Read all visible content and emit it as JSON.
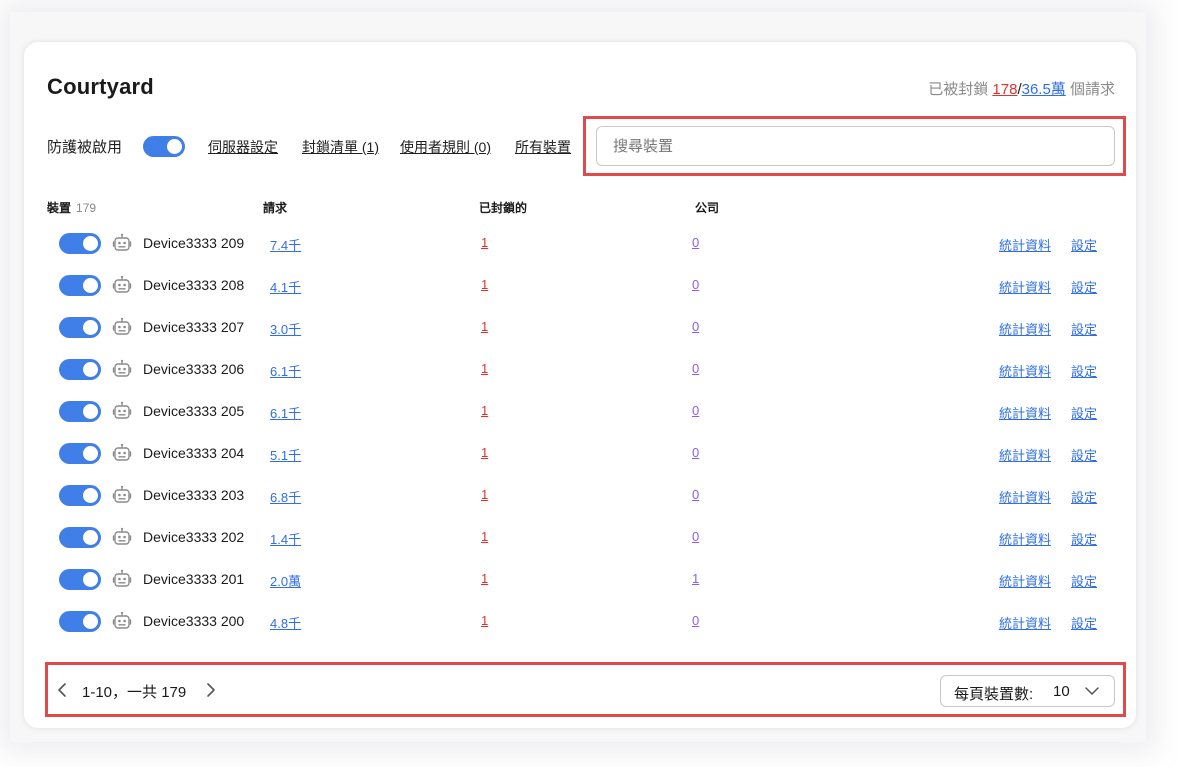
{
  "header": {
    "title": "Courtyard",
    "summary_prefix": "已被封鎖",
    "blocked_count": "178",
    "separator": "/",
    "total_requests": "36.5萬",
    "summary_suffix": "個請求"
  },
  "toolbar": {
    "protection_label": "防護被啟用",
    "links": [
      "伺服器設定",
      "封鎖清單 (1)",
      "使用者規則 (0)",
      "所有裝置"
    ]
  },
  "search": {
    "placeholder": "搜尋裝置",
    "value": ""
  },
  "table": {
    "headers": {
      "device": "裝置",
      "device_count": "179",
      "requests": "請求",
      "blocked": "已封鎖的",
      "company": "公司"
    },
    "rows": [
      {
        "name": "Device3333 209",
        "requests": "7.4千",
        "blocked": "1",
        "company": "0",
        "stats": "統計資料",
        "settings": "設定",
        "enabled": true
      },
      {
        "name": "Device3333 208",
        "requests": "4.1千",
        "blocked": "1",
        "company": "0",
        "stats": "統計資料",
        "settings": "設定",
        "enabled": true
      },
      {
        "name": "Device3333 207",
        "requests": "3.0千",
        "blocked": "1",
        "company": "0",
        "stats": "統計資料",
        "settings": "設定",
        "enabled": true
      },
      {
        "name": "Device3333 206",
        "requests": "6.1千",
        "blocked": "1",
        "company": "0",
        "stats": "統計資料",
        "settings": "設定",
        "enabled": true
      },
      {
        "name": "Device3333 205",
        "requests": "6.1千",
        "blocked": "1",
        "company": "0",
        "stats": "統計資料",
        "settings": "設定",
        "enabled": true
      },
      {
        "name": "Device3333 204",
        "requests": "5.1千",
        "blocked": "1",
        "company": "0",
        "stats": "統計資料",
        "settings": "設定",
        "enabled": true
      },
      {
        "name": "Device3333 203",
        "requests": "6.8千",
        "blocked": "1",
        "company": "0",
        "stats": "統計資料",
        "settings": "設定",
        "enabled": true
      },
      {
        "name": "Device3333 202",
        "requests": "1.4千",
        "blocked": "1",
        "company": "0",
        "stats": "統計資料",
        "settings": "設定",
        "enabled": true
      },
      {
        "name": "Device3333 201",
        "requests": "2.0萬",
        "blocked": "1",
        "company": "1",
        "stats": "統計資料",
        "settings": "設定",
        "enabled": true
      },
      {
        "name": "Device3333 200",
        "requests": "4.8千",
        "blocked": "1",
        "company": "0",
        "stats": "統計資料",
        "settings": "設定",
        "enabled": true
      }
    ]
  },
  "pagination": {
    "range_text": "1-10，一共 179",
    "per_page_label": "每頁裝置數:",
    "per_page_value": "10"
  },
  "colors": {
    "accent": "#3f7fe7",
    "blocked": "#e03131",
    "link": "#2f6fe3",
    "company": "#8b5cf6",
    "highlight": "#e04a4a"
  },
  "icons": {
    "device": "robot-icon",
    "prev": "chevron-left-icon",
    "next": "chevron-right-icon",
    "dropdown": "chevron-down-icon"
  }
}
